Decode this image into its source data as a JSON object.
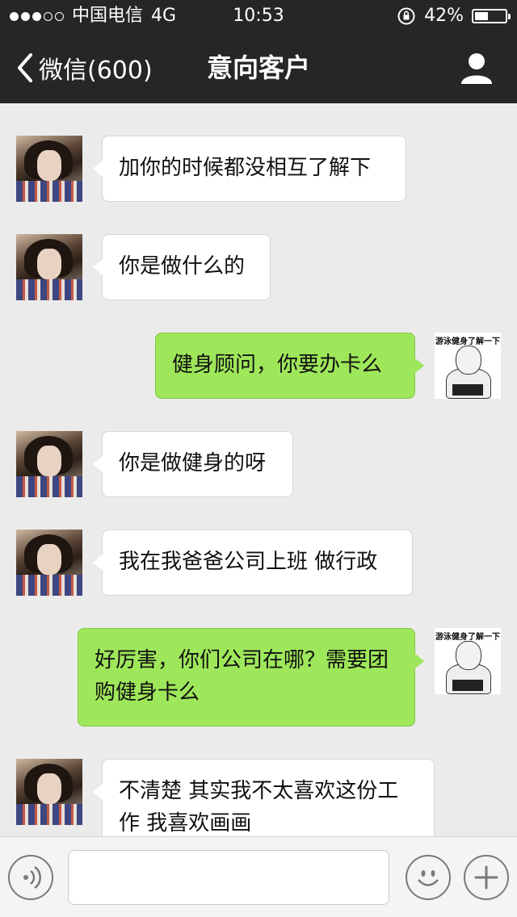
{
  "status_bar": {
    "carrier": "中国电信",
    "network": "4G",
    "time": "10:53",
    "battery": "42%",
    "battery_level": 0.42
  },
  "nav": {
    "back_label": "微信(600)",
    "title": "意向客户"
  },
  "messages": [
    {
      "from": "contact",
      "text": "加你的时候都没相互了解下"
    },
    {
      "from": "contact",
      "text": "你是做什么的"
    },
    {
      "from": "me",
      "text": "健身顾问，你要办卡么"
    },
    {
      "from": "contact",
      "text": "你是做健身的呀"
    },
    {
      "from": "contact",
      "text": "我在我爸爸公司上班 做行政"
    },
    {
      "from": "me",
      "text": "好厉害，你们公司在哪？需要团购健身卡么"
    },
    {
      "from": "contact",
      "text": "不清楚 其实我不太喜欢这份工作 我喜欢画画"
    }
  ],
  "my_avatar_caption": "游泳健身了解一下",
  "colors": {
    "nav_bg": "#262628",
    "chat_bg": "#ebebeb",
    "out_bubble": "#9ee75a",
    "in_bubble": "#ffffff"
  }
}
